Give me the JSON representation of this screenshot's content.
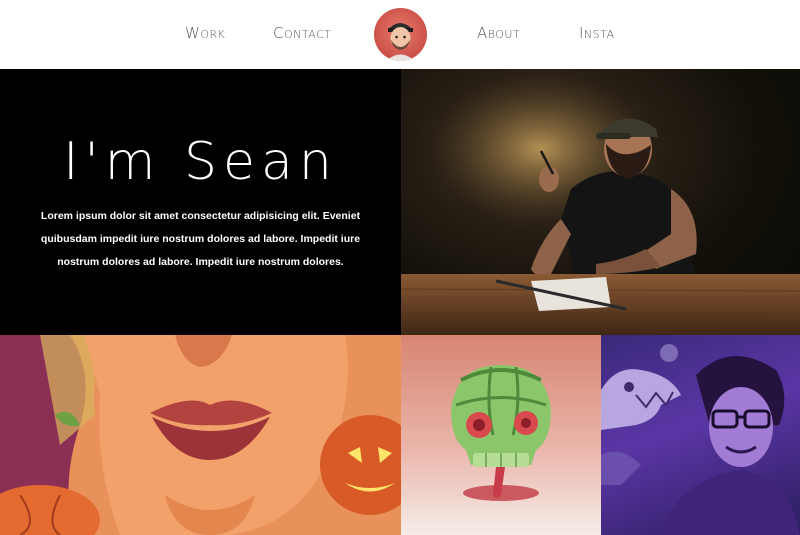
{
  "nav": {
    "work": "Work",
    "contact": "Contact",
    "about": "About",
    "insta": "Insta"
  },
  "hero": {
    "title": "I'm Sean",
    "text": "Lorem ipsum dolor sit amet consectetur adipisicing elit. Eveniet quibusdam impedit iure nostrum dolores ad labore. Impedit iure nostrum dolores ad labore. Impedit iure nostrum dolores."
  },
  "colors": {
    "hero_bg": "#000000",
    "avatar_bg": "#d0544b",
    "nav_text": "#555555"
  },
  "tiles": [
    {
      "name": "artist-photo",
      "icon": "photo"
    },
    {
      "name": "lips-pumpkin-illustration",
      "icon": "illustration"
    },
    {
      "name": "watermelon-skull-illustration",
      "icon": "illustration"
    },
    {
      "name": "jurassic-park-illustration",
      "icon": "illustration"
    }
  ]
}
